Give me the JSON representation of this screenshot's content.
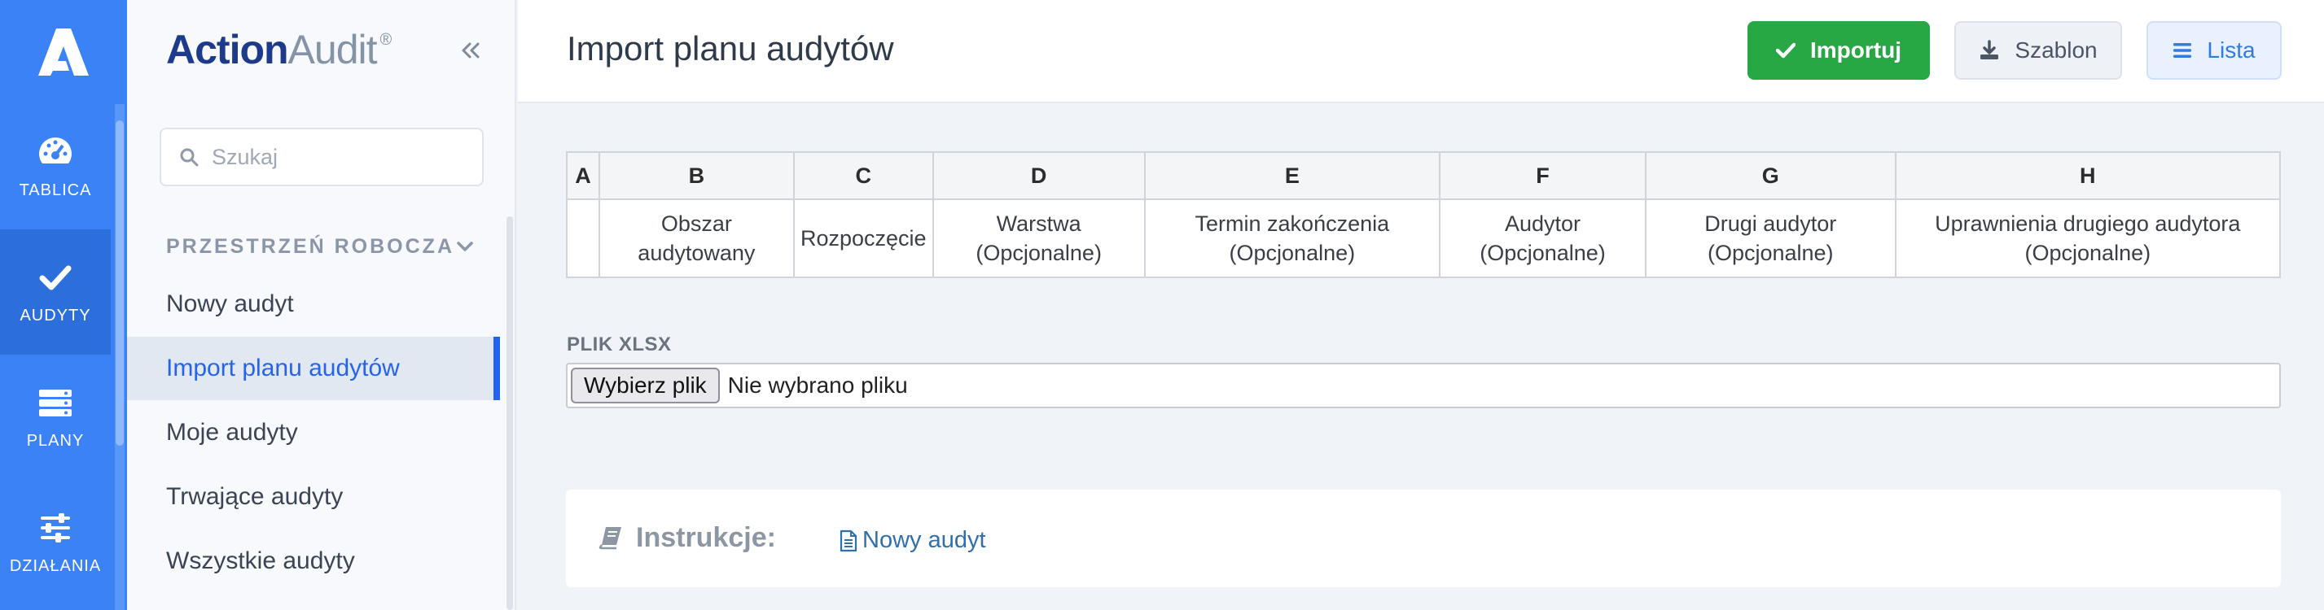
{
  "rail": {
    "logo_icon": "action-audit-logo",
    "items": [
      {
        "label": "TABLICA",
        "icon": "dashboard-icon"
      },
      {
        "label": "AUDYTY",
        "icon": "check-icon",
        "active": true
      },
      {
        "label": "PLANY",
        "icon": "plans-icon"
      },
      {
        "label": "DZIAŁANIA",
        "icon": "sliders-icon"
      }
    ]
  },
  "sidebar": {
    "brand_primary": "Action",
    "brand_secondary": "Audit",
    "brand_mark": "®",
    "search_placeholder": "Szukaj",
    "section_title": "PRZESTRZEŃ ROBOCZA",
    "items": [
      {
        "label": "Nowy audyt"
      },
      {
        "label": "Import planu audytów",
        "active": true
      },
      {
        "label": "Moje audyty"
      },
      {
        "label": "Trwające audyty"
      },
      {
        "label": "Wszystkie audyty"
      }
    ]
  },
  "header": {
    "title": "Import planu audytów",
    "import_label": "Importuj",
    "template_label": "Szablon",
    "list_label": "Lista"
  },
  "columns_table": {
    "headers": [
      "A",
      "B",
      "C",
      "D",
      "E",
      "F",
      "G",
      "H"
    ],
    "cells": [
      [
        "",
        ""
      ],
      [
        "Obszar",
        "audytowany"
      ],
      [
        "Rozpoczęcie",
        ""
      ],
      [
        "Warstwa",
        "(Opcjonalne)"
      ],
      [
        "Termin zakończenia",
        "(Opcjonalne)"
      ],
      [
        "Audytor",
        "(Opcjonalne)"
      ],
      [
        "Drugi audytor",
        "(Opcjonalne)"
      ],
      [
        "Uprawnienia drugiego audytora",
        "(Opcjonalne)"
      ]
    ]
  },
  "file": {
    "label": "PLIK XLSX",
    "button_label": "Wybierz plik",
    "status": "Nie wybrano pliku"
  },
  "instructions": {
    "label": "Instrukcje:",
    "link_label": "Nowy audyt"
  },
  "colors": {
    "rail": "#3b82f6",
    "accent": "#2563eb",
    "import": "#28a745"
  }
}
